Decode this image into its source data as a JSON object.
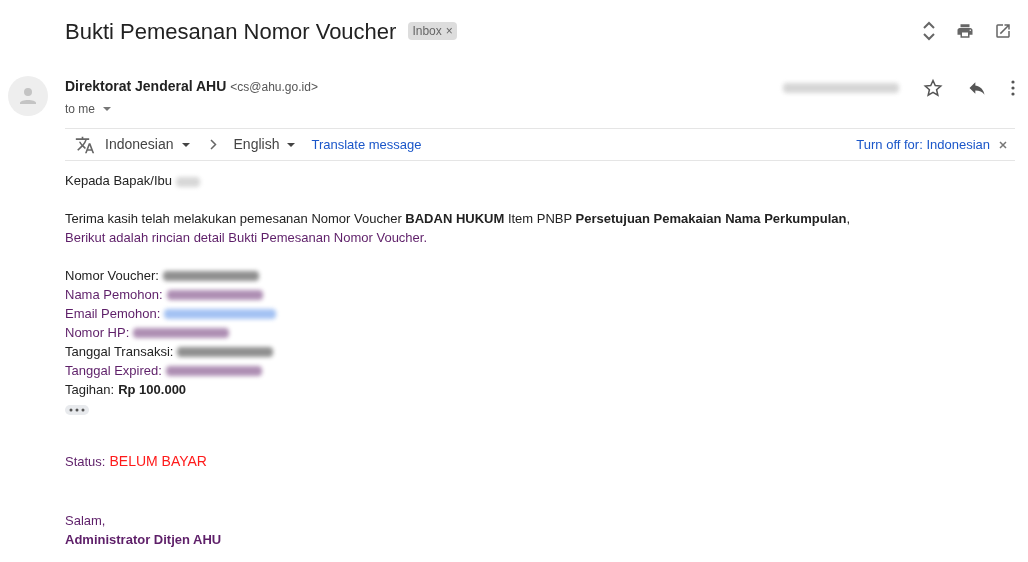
{
  "subject": "Bukti Pemesanan Nomor Voucher",
  "label": {
    "text": "Inbox",
    "remove": "×"
  },
  "sender": {
    "name": "Direktorat Jenderal AHU",
    "email": "<cs@ahu.go.id>",
    "recipient": "to me",
    "time_redacted": true
  },
  "translate": {
    "source": "Indonesian",
    "target": "English",
    "action": "Translate message",
    "turn_off": "Turn off for: Indonesian"
  },
  "greeting": {
    "text": "Kepada Bapak/Ibu",
    "redacted": true
  },
  "intro": "Terima kasih telah melakukan pemesanan Nomor Voucher **BADAN HUKUM** Item PNBP **Persetujuan Pemakaian Nama Perkumpulan**,",
  "intro_note": "Berikut adalah rincian detail Bukti Pemesanan Nomor Voucher.",
  "details": [
    {
      "label": "Nomor Voucher:",
      "color": "#222222",
      "kind": "redacted"
    },
    {
      "label": "Nama Pemohon:",
      "color": "#5e1f69",
      "kind": "redacted"
    },
    {
      "label": "Email Pemohon:",
      "color": "#5e1f69",
      "kind": "redacted_link"
    },
    {
      "label": "Nomor HP:",
      "color": "#5e1f69",
      "kind": "redacted"
    },
    {
      "label": "Tanggal Transaksi:",
      "color": "#222222",
      "kind": "redacted"
    },
    {
      "label": "Tanggal Expired:",
      "color": "#5e1f69",
      "kind": "redacted"
    },
    {
      "label": "Tagihan:",
      "color": "#222222",
      "kind": "value",
      "value": "Rp 100.000"
    }
  ],
  "status": {
    "label": "Status:",
    "value": "BELUM BAYAR"
  },
  "closing": "Salam,",
  "signature": "Administrator Ditjen AHU"
}
